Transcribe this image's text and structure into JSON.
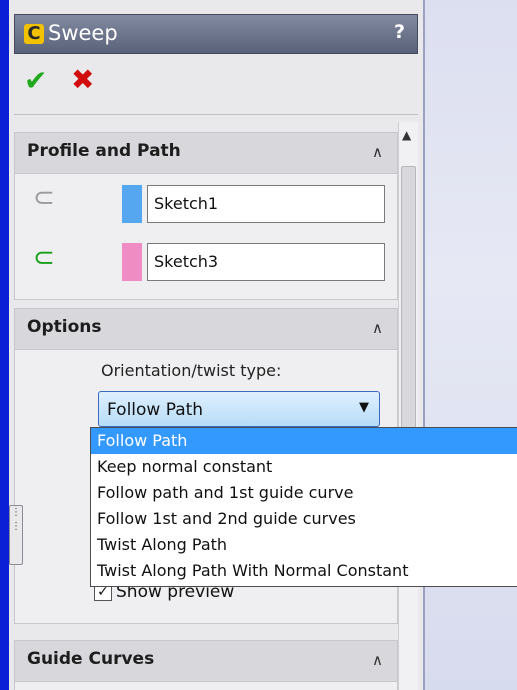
{
  "title_bar": {
    "title": "Sweep",
    "help": "?",
    "icon": "sweep-feature-icon"
  },
  "actions": {
    "ok_icon": "green-checkmark-icon",
    "cancel_icon": "red-x-icon"
  },
  "profile_path": {
    "header": "Profile and Path",
    "profile_value": "Sketch1",
    "profile_color": "#55a8f0",
    "path_value": "Sketch3",
    "path_color": "#f08cc4"
  },
  "options": {
    "header": "Options",
    "orientation_label": "Orientation/twist type:",
    "selected": "Follow Path",
    "dropdown_options": [
      "Follow Path",
      "Keep normal constant",
      "Follow path and 1st guide curve",
      "Follow 1st and 2nd guide curves",
      "Twist Along Path",
      "Twist Along Path With Normal Constant"
    ],
    "show_preview_label": "Show preview",
    "show_preview_checked": true
  },
  "guide_curves": {
    "header": "Guide Curves"
  },
  "colors": {
    "desktop_blue": "#0a1bd0",
    "highlight": "#3399ff"
  }
}
